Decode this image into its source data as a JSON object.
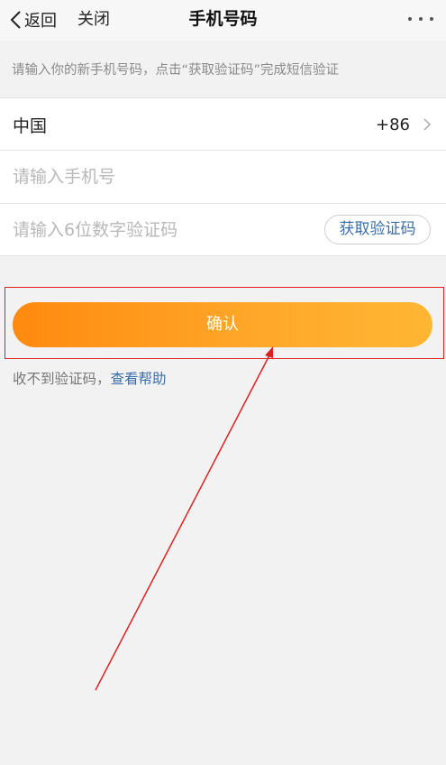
{
  "nav": {
    "back_label": "返回",
    "close_label": "关闭",
    "title": "手机号码"
  },
  "hint": "请输入你的新手机号码，点击“获取验证码”完成短信验证",
  "form": {
    "country_label": "中国",
    "country_code": "+86",
    "phone_placeholder": "请输入手机号",
    "code_placeholder": "请输入6位数字验证码",
    "get_code_label": "获取验证码"
  },
  "confirm_label": "确认",
  "help": {
    "prefix": "收不到验证码，",
    "link": "查看帮助"
  },
  "colors": {
    "accent_orange": "#ff8a0f",
    "link_blue": "#3b6ea8",
    "annotation_red": "#e02020"
  }
}
